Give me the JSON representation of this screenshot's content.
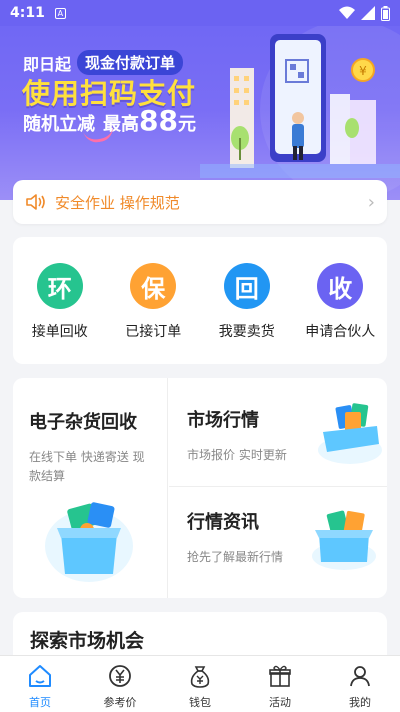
{
  "status_bar": {
    "time": "4:11",
    "notif": "A"
  },
  "banner": {
    "line1_prefix": "即日起",
    "line1_tag": "现金付款订单",
    "headline": "使用扫码支付",
    "line3_prefix": "随机立减",
    "line3_mid": "最高",
    "line3_amount": "88",
    "line3_unit": "元",
    "coin_symbol": "¥"
  },
  "notice": {
    "text": "安全作业 操作规范"
  },
  "actions": [
    {
      "glyph": "环",
      "label": "接单回收",
      "color": "#26c48f"
    },
    {
      "glyph": "保",
      "label": "已接订单",
      "color": "#ffa233"
    },
    {
      "glyph": "回",
      "label": "我要卖货",
      "color": "#2196f3"
    },
    {
      "glyph": "收",
      "label": "申请合伙人",
      "color": "#6b63f2"
    }
  ],
  "cards": {
    "recycle": {
      "title": "电子杂货回收",
      "desc": "在线下单 快递寄送 现款结算"
    },
    "market": {
      "title": "市场行情",
      "desc": "市场报价 实时更新"
    },
    "news": {
      "title": "行情资讯",
      "desc": "抢先了解最新行情"
    }
  },
  "explore": {
    "title": "探索市场机会"
  },
  "bottom_nav": [
    {
      "label": "首页",
      "active": true
    },
    {
      "label": "参考价",
      "active": false
    },
    {
      "label": "钱包",
      "active": false
    },
    {
      "label": "活动",
      "active": false
    },
    {
      "label": "我的",
      "active": false
    }
  ],
  "colors": {
    "accent": "#1f8bff",
    "banner": "#6d66f3",
    "notice": "#f08a2a"
  }
}
